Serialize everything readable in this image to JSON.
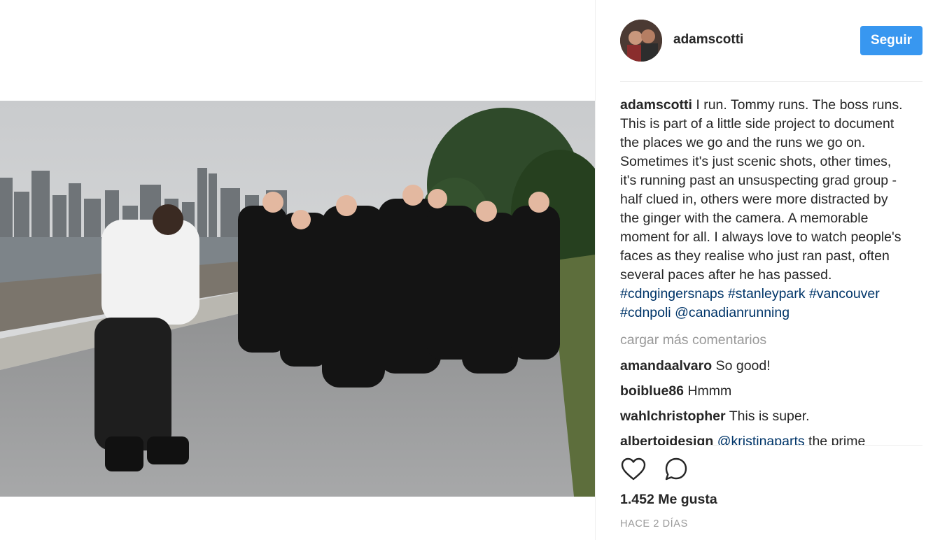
{
  "post": {
    "username": "adamscotti",
    "follow_label": "Seguir",
    "caption_user": "adamscotti",
    "caption_lines": [
      "I run. Tommy runs. The boss runs.",
      "This is part of a little side project to document",
      "the places we go and the runs we go on.",
      "Sometimes it's just scenic shots, other times,",
      "it's running past an unsuspecting grad group -",
      "half clued in, others were more distracted by",
      "the ginger with the camera. A memorable",
      "moment for all. I always love to watch people's",
      "faces as they realise who just ran past, often",
      "several paces after he has passed."
    ],
    "hashtags_line1": [
      "#cdngingersnaps",
      "#stanleypark",
      "#vancouver"
    ],
    "hashtags_line2": [
      "#cdnpoli",
      "@canadianrunning"
    ],
    "load_more": "cargar más comentarios",
    "comments": [
      {
        "user": "amandaalvaro",
        "text": "So good!"
      },
      {
        "user": "boiblue86",
        "text": "Hmmm"
      },
      {
        "user": "wahlchristopher",
        "text": "This is super."
      },
      {
        "user": "albertoidesign",
        "mention": "@kristinaparts",
        "text": "the prime"
      }
    ],
    "likes": "1.452 Me gusta",
    "time": "HACE 2 DÍAS",
    "icons": {
      "like": "heart-icon",
      "comment": "comment-icon"
    },
    "colors": {
      "follow_bg": "#3897f0",
      "link": "#003569",
      "muted": "#999999"
    }
  }
}
